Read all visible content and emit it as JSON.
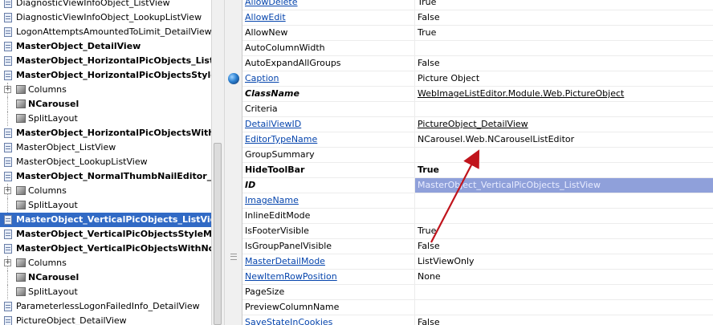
{
  "tree": {
    "items": [
      {
        "label": "DiagnosticViewInfoObject_ListView",
        "icon": "doc",
        "bold": false,
        "level": 0
      },
      {
        "label": "DiagnosticViewInfoObject_LookupListView",
        "icon": "doc",
        "bold": false,
        "level": 0
      },
      {
        "label": "LogonAttemptsAmountedToLimit_DetailView",
        "icon": "doc",
        "bold": false,
        "level": 0
      },
      {
        "label": "MasterObject_DetailView",
        "icon": "doc",
        "bold": true,
        "level": 0
      },
      {
        "label": "MasterObject_HorizontalPicObjects_List...",
        "icon": "doc",
        "bold": true,
        "level": 0
      },
      {
        "label": "MasterObject_HorizontalPicObjectsStyle...",
        "icon": "doc",
        "bold": true,
        "level": 0
      },
      {
        "label": "Columns",
        "icon": "cube",
        "bold": false,
        "level": 1,
        "expander": true
      },
      {
        "label": "NCarousel",
        "icon": "cube",
        "bold": true,
        "level": 1
      },
      {
        "label": "SplitLayout",
        "icon": "cube",
        "bold": false,
        "level": 1
      },
      {
        "label": "MasterObject_HorizontalPicObjectsWith...",
        "icon": "doc",
        "bold": true,
        "level": 0
      },
      {
        "label": "MasterObject_ListView",
        "icon": "doc",
        "bold": false,
        "level": 0
      },
      {
        "label": "MasterObject_LookupListView",
        "icon": "doc",
        "bold": false,
        "level": 0
      },
      {
        "label": "MasterObject_NormalThumbNailEditor_L...",
        "icon": "doc",
        "bold": true,
        "level": 0
      },
      {
        "label": "Columns",
        "icon": "cube",
        "bold": false,
        "level": 1,
        "expander": true
      },
      {
        "label": "SplitLayout",
        "icon": "cube",
        "bold": false,
        "level": 1
      },
      {
        "label": "MasterObject_VerticalPicObjects_ListView",
        "icon": "doc",
        "bold": true,
        "level": 0,
        "selected": true
      },
      {
        "label": "MasterObject_VerticalPicObjectsStyleM...",
        "icon": "doc",
        "bold": true,
        "level": 0
      },
      {
        "label": "MasterObject_VerticalPicObjectsWithNoI...",
        "icon": "doc",
        "bold": true,
        "level": 0
      },
      {
        "label": "Columns",
        "icon": "cube",
        "bold": false,
        "level": 1,
        "expander": true
      },
      {
        "label": "NCarousel",
        "icon": "cube",
        "bold": true,
        "level": 1
      },
      {
        "label": "SplitLayout",
        "icon": "cube",
        "bold": false,
        "level": 1
      },
      {
        "label": "ParameterlessLogonFailedInfo_DetailView",
        "icon": "doc",
        "bold": false,
        "level": 0
      },
      {
        "label": "PictureObject_DetailView",
        "icon": "doc",
        "bold": false,
        "level": 0
      }
    ]
  },
  "properties": [
    {
      "name": "AllowDelete",
      "value": "True",
      "name_link": true
    },
    {
      "name": "AllowEdit",
      "value": "False",
      "name_link": true
    },
    {
      "name": "AllowNew",
      "value": "True"
    },
    {
      "name": "AutoColumnWidth",
      "value": ""
    },
    {
      "name": "AutoExpandAllGroups",
      "value": "False"
    },
    {
      "name": "Caption",
      "value": "Picture Object",
      "name_link": true,
      "globe": true
    },
    {
      "name": "ClassName",
      "value": "WebImageListEditor.Module.Web.PictureObject",
      "name_style": "bold-italic",
      "value_link": true
    },
    {
      "name": "Criteria",
      "value": ""
    },
    {
      "name": "DetailViewID",
      "value": "PictureObject_DetailView",
      "name_link": true,
      "value_link": true
    },
    {
      "name": "EditorTypeName",
      "value": "NCarousel.Web.NCarouselListEditor",
      "name_link": true
    },
    {
      "name": "GroupSummary",
      "value": ""
    },
    {
      "name": "HideToolBar",
      "value": "True",
      "name_bold": true,
      "value_bold": true
    },
    {
      "name": "ID",
      "value": "MasterObject_VerticalPicObjects_ListView",
      "name_style": "bold-italic",
      "value_highlight": true
    },
    {
      "name": "ImageName",
      "value": "",
      "name_link": true
    },
    {
      "name": "InlineEditMode",
      "value": ""
    },
    {
      "name": "IsFooterVisible",
      "value": "True"
    },
    {
      "name": "IsGroupPanelVisible",
      "value": "False"
    },
    {
      "name": "MasterDetailMode",
      "value": "ListViewOnly",
      "name_link": true
    },
    {
      "name": "NewItemRowPosition",
      "value": "None",
      "name_link": true
    },
    {
      "name": "PageSize",
      "value": ""
    },
    {
      "name": "PreviewColumnName",
      "value": ""
    },
    {
      "name": "SaveStateInCookies",
      "value": "False",
      "name_link": true
    }
  ],
  "colors": {
    "selection": "#316ac5",
    "highlight": "#8fa0da",
    "link": "#0645ad",
    "arrow": "#c0141c"
  }
}
